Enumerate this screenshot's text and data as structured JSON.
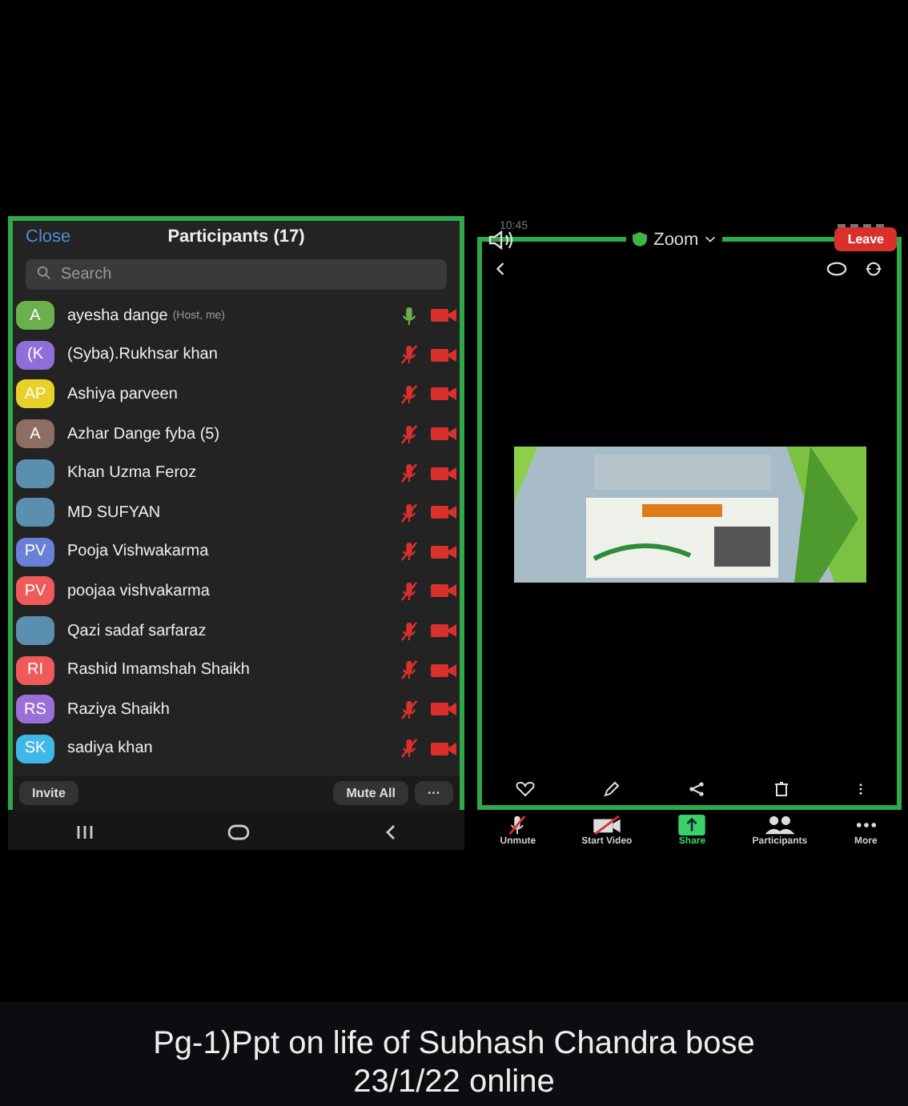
{
  "participants_panel": {
    "close": "Close",
    "title": "Participants (17)",
    "search": {
      "placeholder": "Search"
    },
    "participants": [
      {
        "kind": "initials",
        "initials": "A",
        "color": "#6ab04c",
        "name": "ayesha dange",
        "role": "(Host, me)",
        "muted": false,
        "video_off": true
      },
      {
        "kind": "initials",
        "initials": "(K",
        "color": "#8e6fd8",
        "name": "(Syba).Rukhsar khan",
        "muted": true,
        "video_off": true
      },
      {
        "kind": "initials",
        "initials": "AP",
        "color": "#e8d22a",
        "name": "Ashiya parveen",
        "muted": true,
        "video_off": true
      },
      {
        "kind": "initials",
        "initials": "A",
        "color": "#8d6e63",
        "name": "Azhar Dange fyba (5)",
        "muted": true,
        "video_off": true
      },
      {
        "kind": "photo",
        "name": "Khan Uzma Feroz",
        "muted": true,
        "video_off": true
      },
      {
        "kind": "photo",
        "name": "MD SUFYAN",
        "muted": true,
        "video_off": true
      },
      {
        "kind": "initials",
        "initials": "PV",
        "color": "#6a7fd6",
        "name": "Pooja Vishwakarma",
        "muted": true,
        "video_off": true
      },
      {
        "kind": "initials",
        "initials": "PV",
        "color": "#ef5a5a",
        "name": "poojaa vishvakarma",
        "muted": true,
        "video_off": true
      },
      {
        "kind": "photo",
        "name": "Qazi sadaf sarfaraz",
        "muted": true,
        "video_off": true
      },
      {
        "kind": "initials",
        "initials": "RI",
        "color": "#ef5a5a",
        "name": "Rashid Imamshah Shaikh",
        "muted": true,
        "video_off": true
      },
      {
        "kind": "initials",
        "initials": "RS",
        "color": "#9b6fd8",
        "name": "Raziya Shaikh",
        "muted": true,
        "video_off": true
      },
      {
        "kind": "initials",
        "initials": "SK",
        "color": "#3fb8e8",
        "name": "sadiya khan",
        "muted": true,
        "video_off": true
      }
    ],
    "buttons": {
      "invite": "Invite",
      "mute_all": "Mute All",
      "more": "···"
    }
  },
  "meeting_screen": {
    "status_time": "10:45",
    "title": "Zoom",
    "leave": "Leave",
    "toolbar": [
      {
        "label": "Unmute"
      },
      {
        "label": "Start Video"
      },
      {
        "label": "Share",
        "selected": true
      },
      {
        "label": "Participants",
        "selected": false
      },
      {
        "label": "More"
      }
    ]
  },
  "caption": "Pg-1)Ppt on life of Subhash Chandra bose 23/1/22 online"
}
